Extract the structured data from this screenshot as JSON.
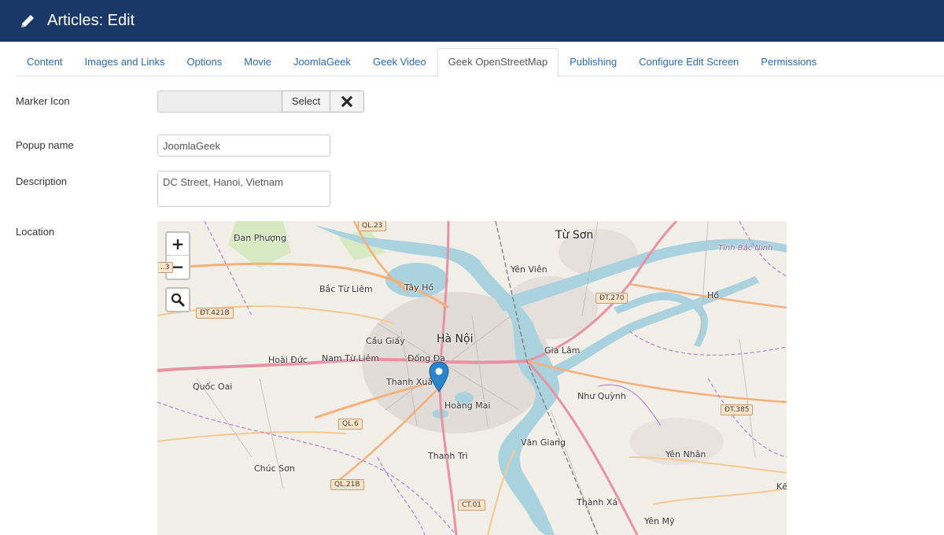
{
  "header": {
    "title": "Articles: Edit",
    "icon": "pencil-icon"
  },
  "tabs": [
    {
      "label": "Content",
      "active": false
    },
    {
      "label": "Images and Links",
      "active": false
    },
    {
      "label": "Options",
      "active": false
    },
    {
      "label": "Movie",
      "active": false
    },
    {
      "label": "JoomlaGeek",
      "active": false
    },
    {
      "label": "Geek Video",
      "active": false
    },
    {
      "label": "Geek OpenStreetMap",
      "active": true
    },
    {
      "label": "Publishing",
      "active": false
    },
    {
      "label": "Configure Edit Screen",
      "active": false
    },
    {
      "label": "Permissions",
      "active": false
    }
  ],
  "form": {
    "marker_icon": {
      "label": "Marker Icon",
      "value": "",
      "select_label": "Select"
    },
    "popup_name": {
      "label": "Popup name",
      "value": "JoomlaGeek"
    },
    "description": {
      "label": "Description",
      "value": "DC Street, Hanoi, Vietnam"
    },
    "location": {
      "label": "Location"
    }
  },
  "map": {
    "zoom_in": "+",
    "zoom_out": "−",
    "places": {
      "dan_phuong": "Đan Phượng",
      "tu_son": "Từ Sơn",
      "tinh_bac_ninh": "Tỉnh Bắc Ninh",
      "yen_vien": "Yên Viên",
      "bac_tu_liem": "Bắc Từ Liêm",
      "tay_ho": "Tây Hồ",
      "ho": "Hồ",
      "cau_giay": "Cầu Giấy",
      "ha_noi": "Hà Nội",
      "gia_lam": "Gia Lâm",
      "hoai_duc": "Hoài Đức",
      "nam_tu_liem": "Nam Từ Liêm",
      "dong_da": "Đống Đa",
      "quoc_oai": "Quốc Oai",
      "thanh_xuan": "Thanh Xuân",
      "nhu_quynh": "Như Quỳnh",
      "hoang_mai": "Hoàng Mai",
      "thanh_tri": "Thanh Trì",
      "van_giang": "Văn Giang",
      "yen_nhan": "Yên Nhân",
      "chuc_son": "Chúc Sơn",
      "thanh_xa": "Thành Xá",
      "yen_my": "Yên Mỹ",
      "ke": "Kế",
      "partial_3": "..3"
    },
    "roads": {
      "ql23": "QL.23",
      "dt270": "ĐT.270",
      "dt421b": "ĐT.421B",
      "ql6": "QL.6",
      "dt385": "ĐT.385",
      "ql21b": "QL.21B",
      "ct01": "CT.01"
    }
  }
}
